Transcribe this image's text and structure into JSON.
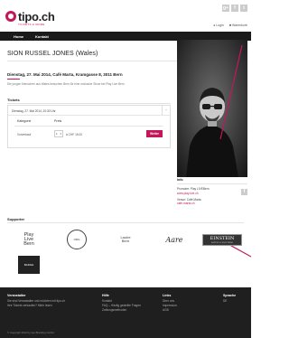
{
  "brand": {
    "name": "tipo.ch",
    "tagline": "TICKETS & MORE"
  },
  "social": {
    "google": "g+",
    "facebook": "f",
    "twitter": "t"
  },
  "userlinks": {
    "login": "Login",
    "cart": "Warenkorb"
  },
  "nav": {
    "home": "Home",
    "contact": "Kontakt"
  },
  "event": {
    "title": "SION RUSSEL JONES (Wales)",
    "date_line": "Dienstag, 27. Mai 2014, Café Marta, Kramgasse 8, 3011 Bern",
    "description": "Die jungen Menschen aus Wales besuchen Bern für eine exklusive Show bei Play Live Bern"
  },
  "tickets": {
    "label": "Tickets",
    "date_option": "Dienstag, 27. Mai 2014, 20:30 Uhr",
    "toggle": "−",
    "columns": [
      "Kategorie",
      "Preis"
    ],
    "rows": [
      {
        "category": "Vorverkauf",
        "qty": "1",
        "price": "à CHF 15.00"
      }
    ],
    "buy_label": "Weiter"
  },
  "info": {
    "heading": "Info",
    "organizer_label": "Promoter: Play LIVEBern",
    "organizer_link": "www.play-live.ch",
    "venue_label": "Venue: Café Marta",
    "venue_link": "cafe-marta.ch"
  },
  "supporter": {
    "label": "Supporter",
    "sponsors": [
      {
        "name": "Play Live Bern",
        "text": "Play\nLive\nBern"
      },
      {
        "name": "Circle Logo",
        "text": "ORG"
      },
      {
        "name": "Laube",
        "text": "Laube\nBern"
      },
      {
        "name": "Aare",
        "text": "Aare"
      },
      {
        "name": "Einstein",
        "text": "EINSTEIN",
        "sub": "KAFFEE & RAUCHBAR"
      },
      {
        "name": "Badge",
        "text": "BADGE"
      }
    ]
  },
  "footer": {
    "col1": {
      "heading": "Veranstalter",
      "lines": [
        "Sie sind Veranstalter und möchten mit tipo.ch",
        "Ihre Tickets verkaufen? Mehr lesen"
      ]
    },
    "col2": {
      "heading": "Hilfe",
      "lines": [
        "Kontakt",
        "FAQ – Häufig gestellte Fragen",
        "Zahlungsmethoden"
      ]
    },
    "col3": {
      "heading": "Links",
      "lines": [
        "Über uns",
        "Impressum",
        "AGB"
      ]
    },
    "col4": {
      "heading": "Sprache",
      "lines": [
        "DE"
      ]
    },
    "copyright": "© Copyright 2014 by tipo Branding GmbH"
  },
  "colors": {
    "accent": "#c2185b",
    "nav_bg": "#1a1a1a",
    "footer_bg": "#1f1f1f"
  },
  "icons": {
    "user": "user-icon",
    "cart": "cart-icon"
  }
}
